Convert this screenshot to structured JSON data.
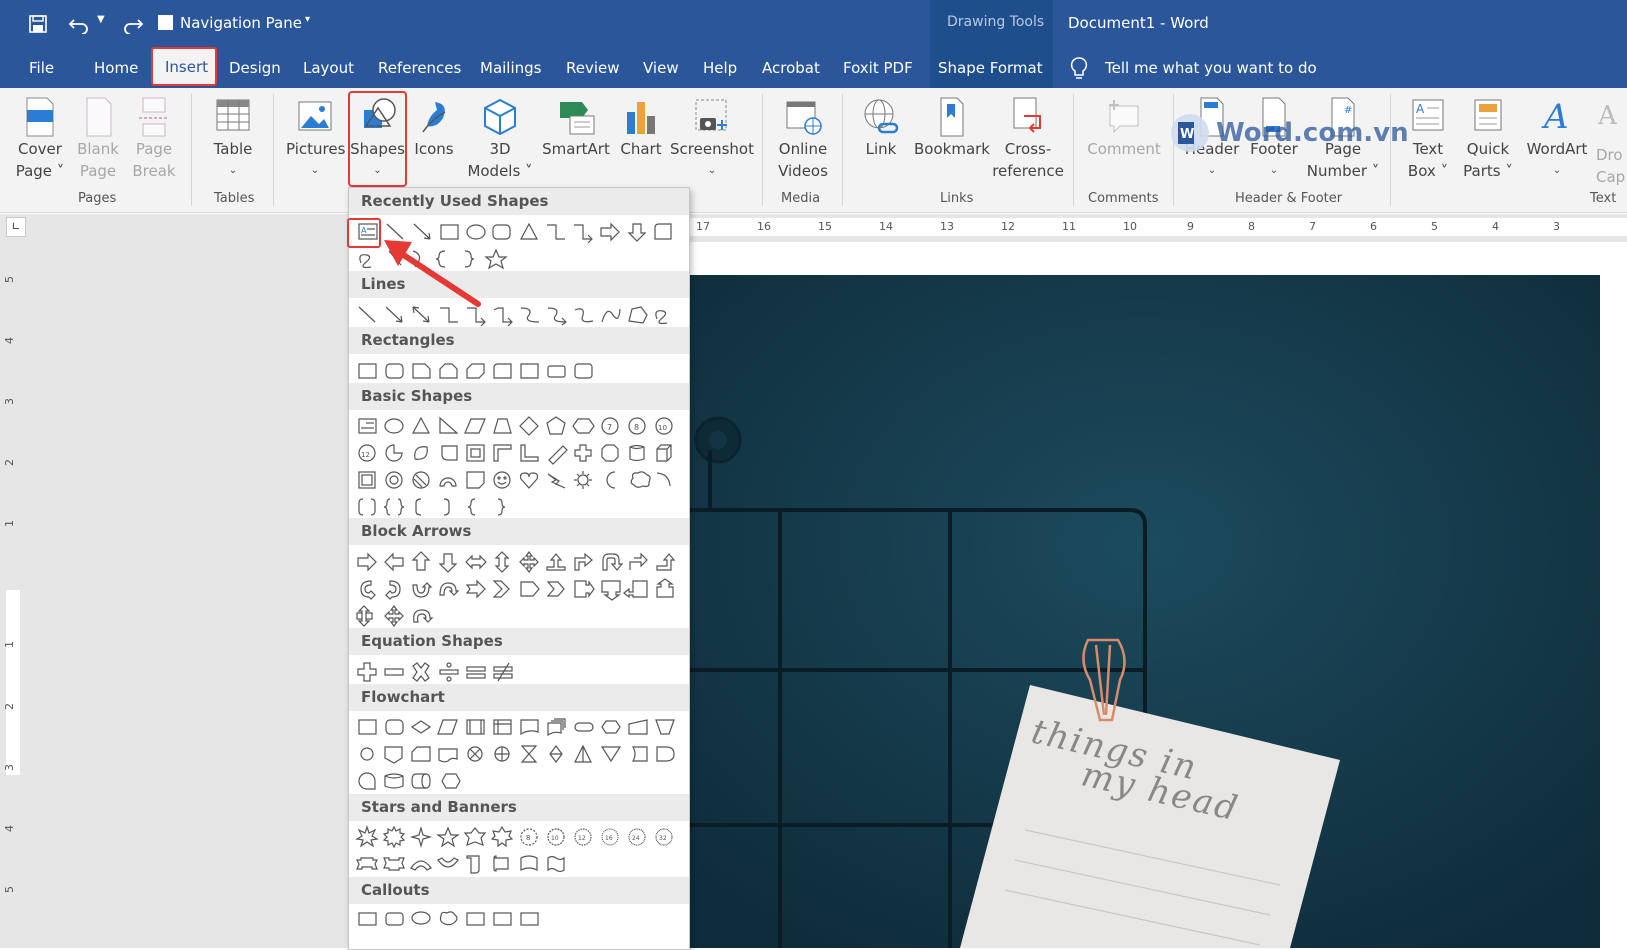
{
  "title_bar": {
    "nav_pane_label": "Navigation Pane",
    "drawing_tools": "Drawing Tools",
    "doc_title": "Document1  -  Word"
  },
  "tabs": [
    "File",
    "Home",
    "Insert",
    "Design",
    "Layout",
    "References",
    "Mailings",
    "Review",
    "View",
    "Help",
    "Acrobat",
    "Foxit PDF",
    "Shape Format"
  ],
  "tell_me": "Tell me what you want to do",
  "ribbon": {
    "cover_page": [
      "Cover",
      "Page ˅"
    ],
    "blank_page": [
      "Blank",
      "Page"
    ],
    "page_break": [
      "Page",
      "Break"
    ],
    "table": "Table",
    "pictures": "Pictures",
    "shapes": "Shapes",
    "icons": "Icons",
    "models3d": [
      "3D",
      "Models ˅"
    ],
    "smartart": "SmartArt",
    "chart": "Chart",
    "screenshot": "Screenshot",
    "online_videos": [
      "Online",
      "Videos"
    ],
    "link": "Link",
    "bookmark": "Bookmark",
    "cross_reference": [
      "Cross-",
      "reference"
    ],
    "comment": "Comment",
    "header": "Header",
    "footer": "Footer",
    "page_number": [
      "Page",
      "Number ˅"
    ],
    "text_box": [
      "Text",
      "Box ˅"
    ],
    "quick_parts": [
      "Quick",
      "Parts ˅"
    ],
    "wordart": "WordArt",
    "drop_cap": [
      "Dro",
      "Cap"
    ],
    "groups": {
      "pages": "Pages",
      "tables": "Tables",
      "media": "Media",
      "links": "Links",
      "comments": "Comments",
      "header_footer": "Header & Footer",
      "text": "Text"
    }
  },
  "watermark": "Word.com.vn",
  "ruler_h": [
    "17",
    "16",
    "15",
    "14",
    "13",
    "12",
    "11",
    "10",
    "9",
    "8",
    "7",
    "6",
    "5",
    "4",
    "3"
  ],
  "ruler_v": [
    "5",
    "4",
    "3",
    "2",
    "1",
    "1",
    "2",
    "3",
    "4",
    "5"
  ],
  "gallery": {
    "sections": [
      "Recently Used Shapes",
      "Lines",
      "Rectangles",
      "Basic Shapes",
      "Block Arrows",
      "Equation Shapes",
      "Flowchart",
      "Stars and Banners",
      "Callouts"
    ]
  },
  "note": {
    "line1": "things  in",
    "line2": "my  head"
  },
  "colors": {
    "word_blue": "#2b579a",
    "highlight_red": "#e53935",
    "photo_bg": "#15384a"
  }
}
